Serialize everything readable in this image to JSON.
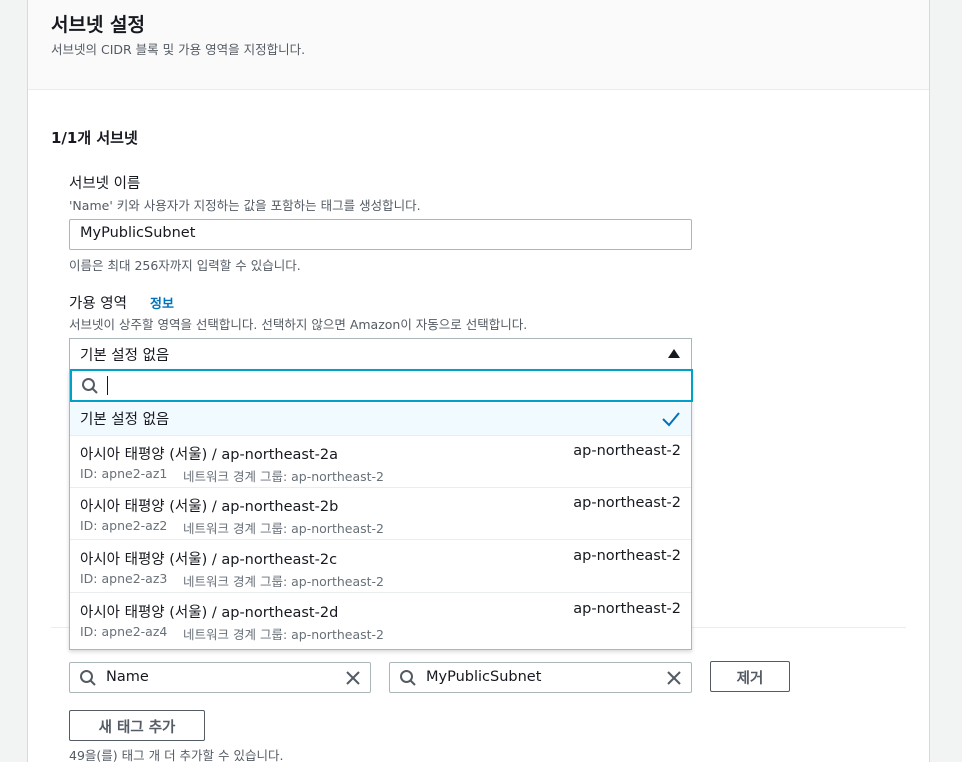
{
  "header": {
    "title": "서브넷 설정",
    "description": "서브넷의 CIDR 블록 및 가용 영역을 지정합니다."
  },
  "subnet_count": "1/1개 서브넷",
  "name_field": {
    "label": "서브넷 이름",
    "description": "'Name' 키와 사용자가 지정하는 값을 포함하는 태그를 생성합니다.",
    "value": "MyPublicSubnet",
    "hint": "이름은 최대 256자까지 입력할 수 있습니다."
  },
  "az_field": {
    "label": "가용 영역",
    "info_link": "정보",
    "description": "서브넷이 상주할 영역을 선택합니다. 선택하지 않으면 Amazon이 자동으로 선택합니다.",
    "selected": "기본 설정 없음",
    "filter_value": ""
  },
  "dropdown": {
    "default_option": "기본 설정 없음",
    "options": [
      {
        "title": "아시아 태평양 (서울) / ap-northeast-2a",
        "tag": "ap-northeast-2",
        "id": "ID: apne2-az1",
        "group": "네트워크 경계 그룹: ap-northeast-2"
      },
      {
        "title": "아시아 태평양 (서울) / ap-northeast-2b",
        "tag": "ap-northeast-2",
        "id": "ID: apne2-az2",
        "group": "네트워크 경계 그룹: ap-northeast-2"
      },
      {
        "title": "아시아 태평양 (서울) / ap-northeast-2c",
        "tag": "ap-northeast-2",
        "id": "ID: apne2-az3",
        "group": "네트워크 경계 그룹: ap-northeast-2"
      },
      {
        "title": "아시아 태평양 (서울) / ap-northeast-2d",
        "tag": "ap-northeast-2",
        "id": "ID: apne2-az4",
        "group": "네트워크 경계 그룹: ap-northeast-2"
      }
    ]
  },
  "tags": {
    "key_value": "Name",
    "value_value": "MyPublicSubnet",
    "remove_label": "제거",
    "add_label": "새 태그 추가",
    "remaining_text": "49을(를) 태그 개 더 추가할 수 있습니다."
  },
  "icons": {
    "search": "search-icon",
    "clear": "close-icon",
    "caret": "caret-up-icon",
    "check": "check-icon"
  },
  "colors": {
    "accent": "#0073bb",
    "focus": "#00a1c9",
    "selected_bg": "#f1faff"
  }
}
